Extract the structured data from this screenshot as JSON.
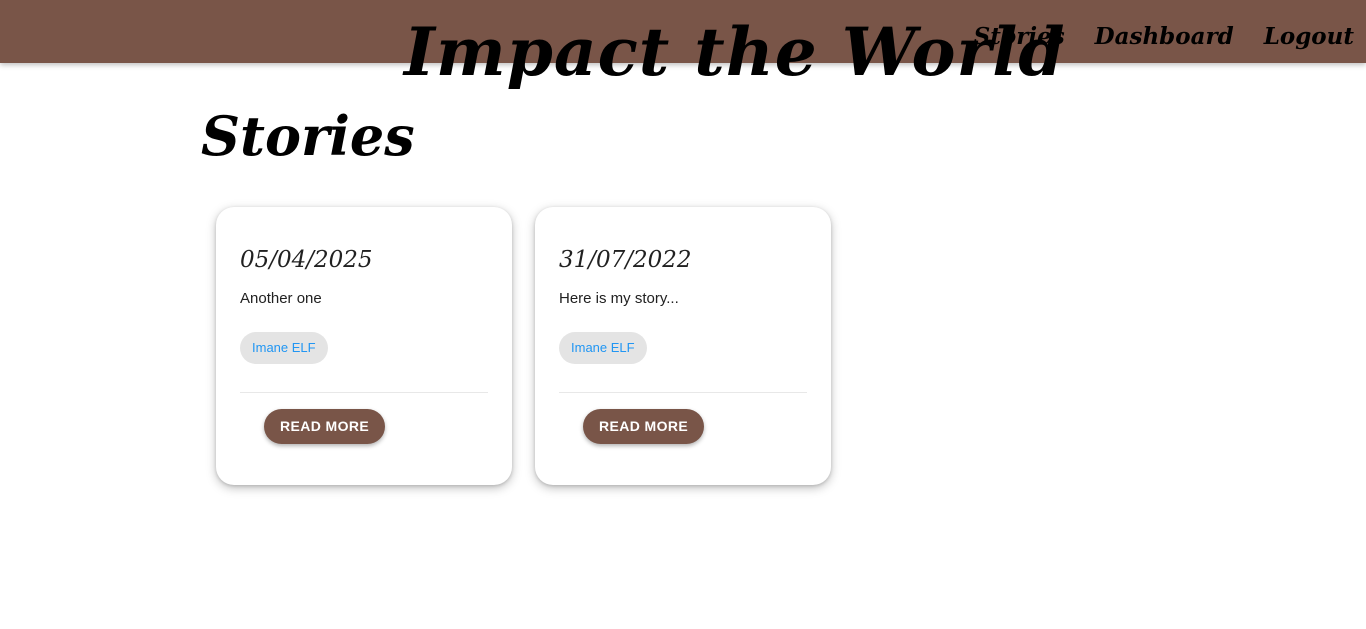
{
  "header": {
    "brand": "Impact the World",
    "nav": {
      "stories": "Stories",
      "dashboard": "Dashboard",
      "logout": "Logout"
    }
  },
  "page": {
    "title": "Stories"
  },
  "stories": [
    {
      "date": "05/04/2025",
      "excerpt": "Another one",
      "author": "Imane ELF",
      "action": "Read more"
    },
    {
      "date": "31/07/2022",
      "excerpt": "Here is my story...",
      "author": "Imane ELF",
      "action": "Read more"
    }
  ],
  "colors": {
    "brand": "#795548",
    "chip_bg": "#e4e4e4",
    "chip_text": "#2196f3"
  }
}
